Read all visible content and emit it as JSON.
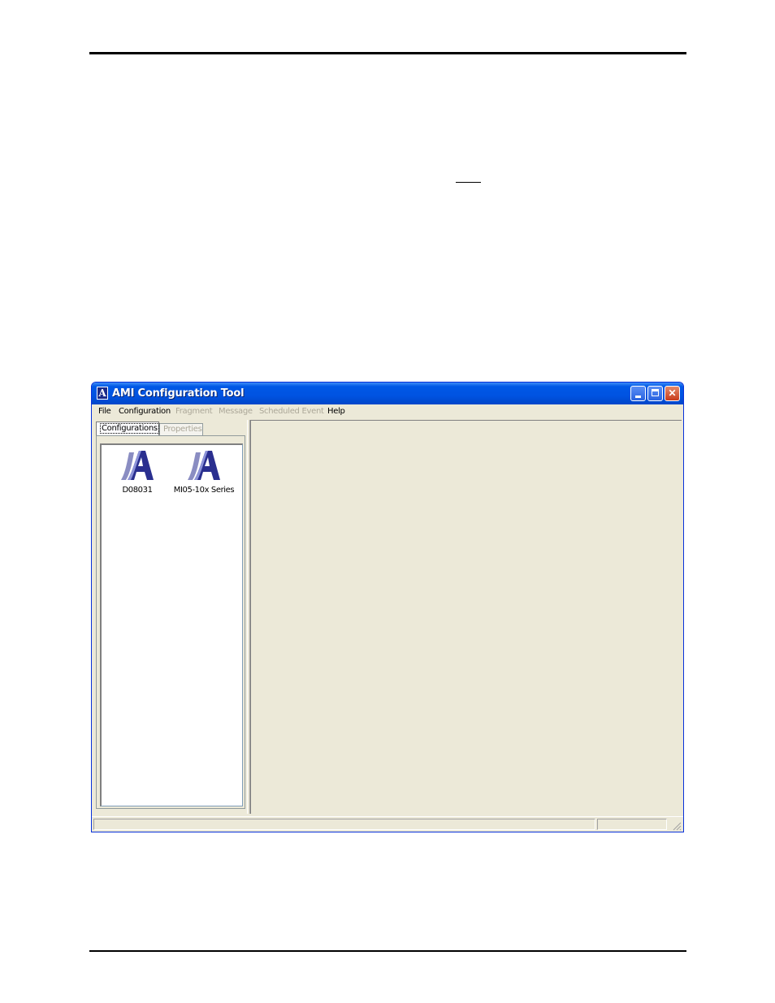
{
  "window": {
    "title": "AMI Configuration Tool",
    "icon": "ami-logo-icon"
  },
  "menu": [
    {
      "label": "File",
      "enabled": true
    },
    {
      "label": "Configuration",
      "enabled": true
    },
    {
      "label": "Fragment",
      "enabled": false
    },
    {
      "label": "Message",
      "enabled": false
    },
    {
      "label": "Scheduled Event",
      "enabled": false
    },
    {
      "label": "Help",
      "enabled": true
    }
  ],
  "tabs": [
    {
      "label": "Configurations",
      "active": true
    },
    {
      "label": "Properties",
      "active": false
    }
  ],
  "items": [
    {
      "label": "D08031",
      "icon": "ami-logo-icon"
    },
    {
      "label": "MI05-10x Series",
      "icon": "ami-logo-icon"
    }
  ],
  "status": {
    "left": "",
    "right": ""
  },
  "colors": {
    "titlebar": "#0053e1",
    "chrome": "#ece9d8",
    "disabled_text": "#aca899",
    "logo": "#2a2f8f"
  }
}
